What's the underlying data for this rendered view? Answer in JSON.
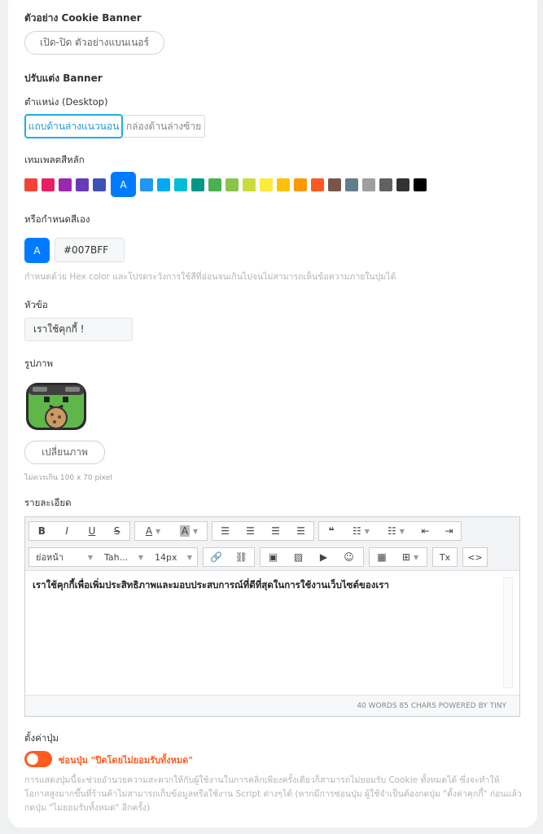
{
  "preview": {
    "heading": "ตัวอย่าง Cookie Banner",
    "toggle_button": "เปิด-ปิด ตัวอย่างแบนเนอร์"
  },
  "customize": {
    "heading": "ปรับแต่ง Banner"
  },
  "position": {
    "label": "ตำแหน่ง (Desktop)",
    "options": [
      "แถบด้านล่างแนวนอน",
      "กล่องด้านล่างซ้าย"
    ],
    "selected": "แถบด้านล่างแนวนอน"
  },
  "template_colors": {
    "label": "เทมเพลตสีหลัก",
    "selected_mark": "A",
    "colors": [
      "#f44336",
      "#e91e63",
      "#9c27b0",
      "#673ab7",
      "#3f51b5",
      "#007bff",
      "#2196f3",
      "#03a9f4",
      "#00bcd4",
      "#009688",
      "#4caf50",
      "#8bc34a",
      "#cddc39",
      "#ffeb3b",
      "#ffc107",
      "#ff9800",
      "#ff5722",
      "#795548",
      "#607d8b",
      "#9e9e9e",
      "#616161",
      "#333333",
      "#000000"
    ]
  },
  "custom_color": {
    "label": "หรือกำหนดสีเอง",
    "preview_mark": "A",
    "value": "#007BFF",
    "help": "กำหนดด้วย Hex color และโปรดระวังการใช้สีที่อ่อนจนเกินไปจนไม่สามารถเห็นข้อความภายในปุ่มได้"
  },
  "title_field": {
    "label": "หัวข้อ",
    "value": "เราใช้คุกกี้ !"
  },
  "image": {
    "label": "รูปภาพ",
    "change_button": "เปลี่ยนภาพ",
    "hint": "ไม่ควรเกิน 100 x 70 pixel"
  },
  "details": {
    "label": "รายละเอียด",
    "toolbar": {
      "bold": "B",
      "italic": "I",
      "underline": "U",
      "strikethrough": "S",
      "text_color": "A",
      "bg_color": "A",
      "quote": "❝",
      "format": "ย่อหน้า",
      "font": "Tah...",
      "size": "14px",
      "clear_format": "Tx",
      "code": "<>"
    },
    "content": "เราใช้คุกกี้เพื่อเพิ่มประสิทธิภาพและมอบประสบการณ์ที่ดีที่สุดในการใช้งานเว็บไซต์ของเรา",
    "status": "40 WORDS 85 CHARS POWERED BY TINY"
  },
  "button_settings": {
    "label": "ตั้งค่าปุ่ม",
    "toggle_label": "ซ่อนปุ่ม \"ปิดโดยไม่ยอมรับทั้งหมด\"",
    "toggle_on": true,
    "help": "การแสดงปุ่มนี้จะช่วยอำนวยความสะดวกให้กับผู้ใช้งานในการคลิกเพียงครั้งเดียวก็สามารถไม่ยอมรับ Cookie ทั้งหมดได้ ซึ่งจะทำให้โอกาสสูงมากขึ้นที่ร้านค้าไม่สามารถเก็บข้อมูลหรือใช้งาน Script ต่างๆได้ (หากมีการซ่อนปุ่ม ผู้ใช้จำเป็นต้องกดปุ่ม \"ตั้งค่าคุกกี้\" ก่อนแล้วกดปุ่ม \"ไม่ยอมรับทั้งหมด\" อีกครั้ง)"
  },
  "accent_color": "#ff5a1f"
}
